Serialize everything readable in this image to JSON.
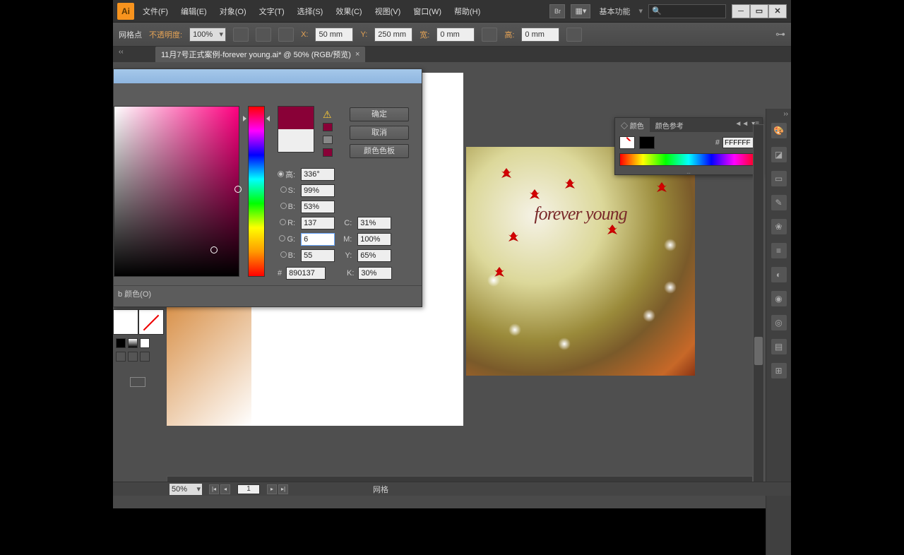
{
  "menubar": {
    "logo": "Ai",
    "items": [
      "文件(F)",
      "编辑(E)",
      "对象(O)",
      "文字(T)",
      "选择(S)",
      "效果(C)",
      "视图(V)",
      "窗口(W)",
      "帮助(H)"
    ],
    "br": "Br",
    "workspace": "基本功能",
    "search": ""
  },
  "controlbar": {
    "object_label": "网格点",
    "opacity_label": "不透明度:",
    "opacity_value": "100%",
    "x_label": "X:",
    "x_value": "50 mm",
    "y_label": "Y:",
    "y_value": "250 mm",
    "w_label": "宽:",
    "w_value": "0 mm",
    "h_label": "高:",
    "h_value": "0 mm"
  },
  "tab": {
    "title": "11月7号正式案例-forever young.ai* @ 50% (RGB/预览)"
  },
  "artwork": {
    "text": "forever young"
  },
  "picker": {
    "ok": "确定",
    "cancel": "取消",
    "swatches": "颜色色板",
    "h_label": "高:",
    "h_val": "336°",
    "s_label": "S:",
    "s_val": "99%",
    "b_label": "B:",
    "b_val": "53%",
    "r_label": "R:",
    "r_val": "137",
    "g_label": "G:",
    "g_val": "6",
    "bl_label": "B:",
    "bl_val": "55",
    "c_label": "C:",
    "c_val": "31%",
    "m_label": "M:",
    "m_val": "100%",
    "y_label": "Y:",
    "y_val": "65%",
    "k_label": "K:",
    "k_val": "30%",
    "hash_label": "#",
    "hash_val": "890137",
    "web_label": "b 颜色(O)",
    "new_color": "#890137",
    "old_color": "#eeeeee"
  },
  "color_panel": {
    "tab1": "◇ 颜色",
    "tab2": "颜色参考",
    "hex_label": "#",
    "hex_value": "FFFFFF"
  },
  "status": {
    "zoom": "50%",
    "page": "1",
    "tool": "网格"
  }
}
